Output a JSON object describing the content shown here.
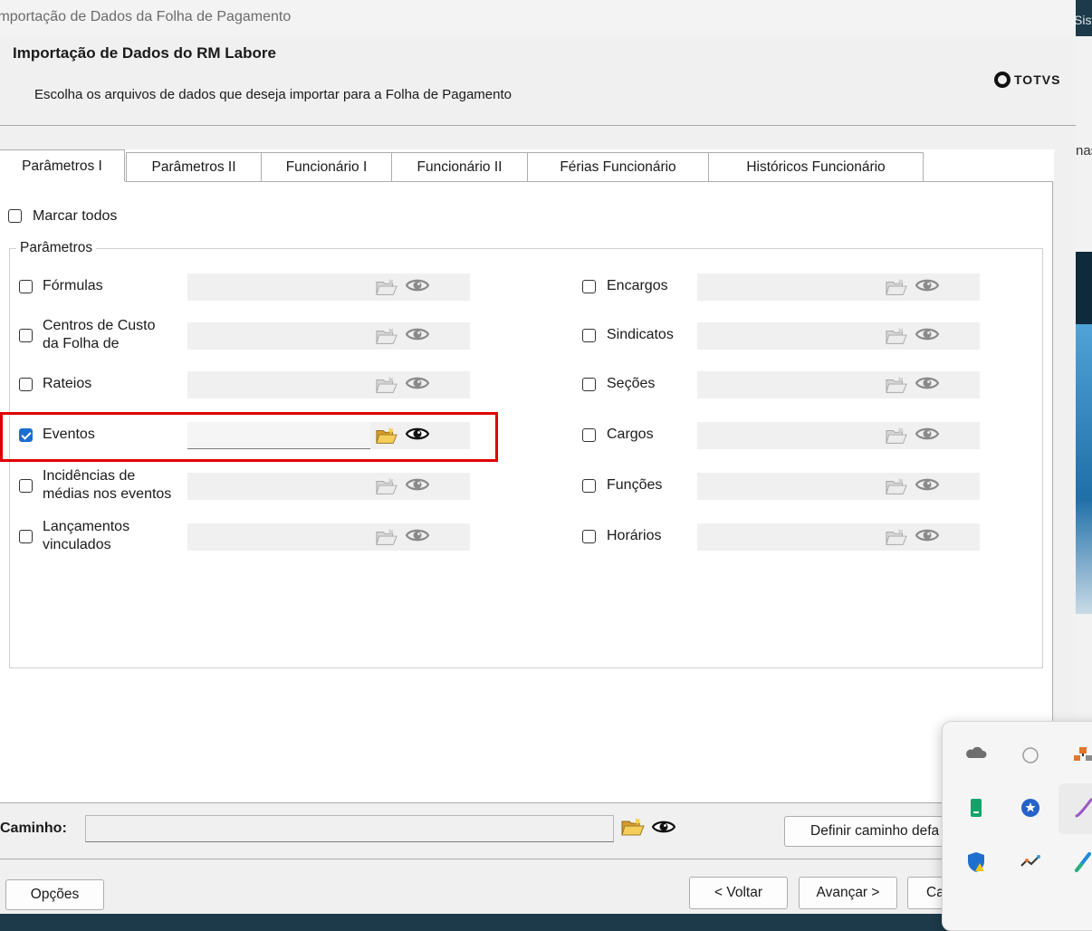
{
  "window": {
    "title": "Importação de Dados da Folha de Pagamento"
  },
  "header": {
    "title": "Importação de Dados do RM Labore",
    "subtitle": "Escolha os arquivos de dados que deseja importar para a Folha de Pagamento",
    "logo_text": "TOTVS"
  },
  "background_app": {
    "text_top": "Sist",
    "text_mid": "nas"
  },
  "tabs": [
    {
      "label": "Parâmetros I",
      "active": true
    },
    {
      "label": "Parâmetros II"
    },
    {
      "label": "Funcionário I"
    },
    {
      "label": "Funcionário II"
    },
    {
      "label": "Férias Funcionário"
    },
    {
      "label": "Históricos Funcionário"
    }
  ],
  "mark_all": {
    "label": "Marcar todos",
    "checked": false
  },
  "group": {
    "legend": "Parâmetros"
  },
  "left_items": [
    {
      "label": "Fórmulas",
      "checked": false
    },
    {
      "label": "Centros de Custo\nda Folha de",
      "checked": false
    },
    {
      "label": "Rateios",
      "checked": false
    },
    {
      "label": "Eventos",
      "checked": true
    },
    {
      "label": "Incidências de\nmédias nos eventos",
      "checked": false
    },
    {
      "label": "Lançamentos\nvinculados",
      "checked": false
    }
  ],
  "right_items": [
    {
      "label": "Encargos",
      "checked": false
    },
    {
      "label": "Sindicatos",
      "checked": false
    },
    {
      "label": "Seções",
      "checked": false
    },
    {
      "label": "Cargos",
      "checked": false
    },
    {
      "label": "Funções",
      "checked": false
    },
    {
      "label": "Horários",
      "checked": false
    }
  ],
  "path": {
    "label": "Caminho:",
    "value": ""
  },
  "buttons": {
    "set_default": "Definir caminho defa",
    "options": "Opções",
    "back": "< Voltar",
    "next": "Avançar >",
    "cancel": "Cancelar"
  },
  "colors": {
    "checkbox_checked": "#1a6fcf",
    "highlight": "#e00000",
    "folder": "#e8b83a"
  },
  "tray_icons": [
    "cloud-icon",
    "circle-icon",
    "network-icon",
    "phone-icon",
    "star-icon",
    "pen-icon",
    "shield-warning-icon",
    "graph-icon",
    "brush-icon"
  ]
}
